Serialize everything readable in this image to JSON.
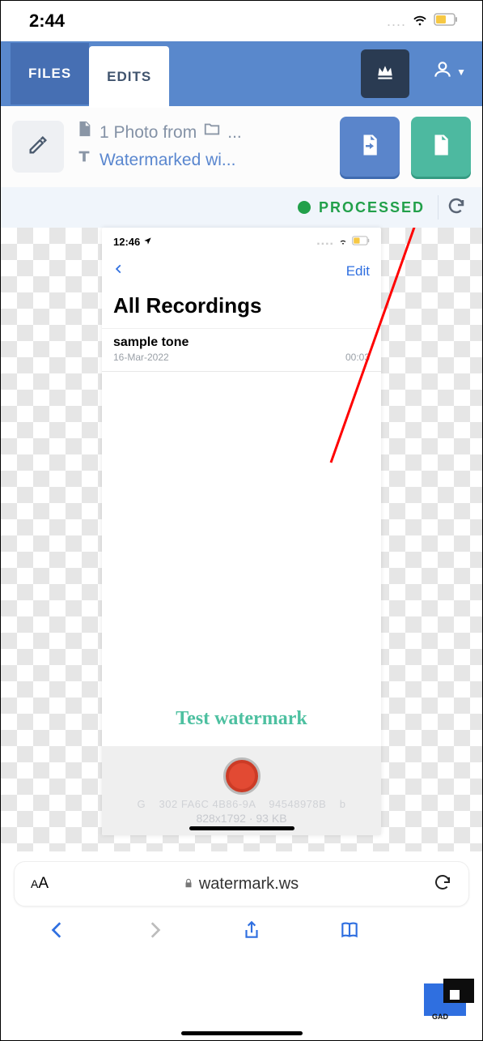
{
  "status": {
    "time": "2:44"
  },
  "tabs": {
    "files": "FILES",
    "edits": "EDITS"
  },
  "fileinfo": {
    "line1": "1 Photo from",
    "line1_suffix": "...",
    "line2": "Watermarked wi..."
  },
  "processed": {
    "label": "PROCESSED"
  },
  "preview": {
    "status_time": "12:46",
    "nav_edit": "Edit",
    "title": "All Recordings",
    "item_name": "sample tone",
    "item_date": "16-Mar-2022",
    "item_dur": "00:03",
    "watermark": "Test watermark",
    "meta1": "G    302 FA6C 4B86-9A    94548978B    b",
    "meta2": "828x1792 · 93 KB"
  },
  "safari": {
    "aa": "AA",
    "domain": "watermark.ws"
  },
  "badge": "GAD"
}
